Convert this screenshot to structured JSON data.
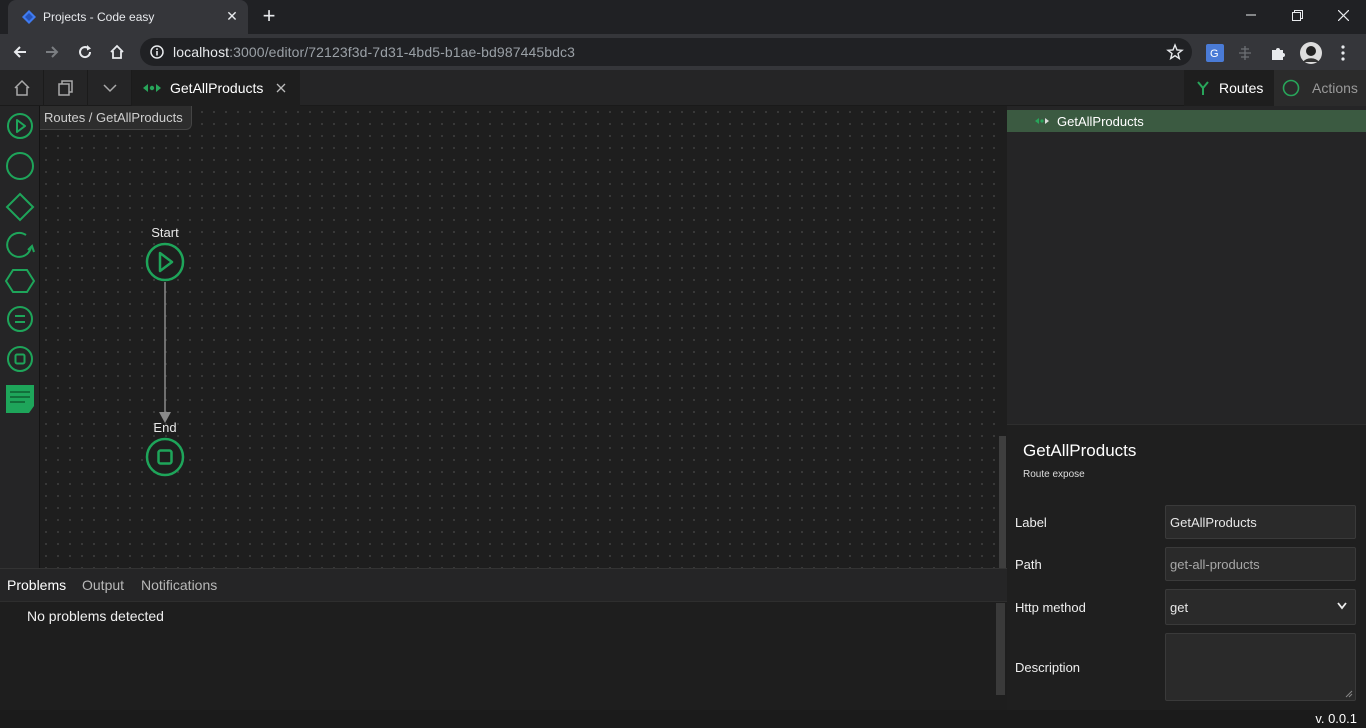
{
  "browser": {
    "tab_title": "Projects - Code easy",
    "url_host": "localhost",
    "url_rest": ":3000/editor/72123f3d-7d31-4bd5-b1ae-bd987445bdc3"
  },
  "editor": {
    "open_tab": "GetAllProducts",
    "right_tabs": {
      "routes": "Routes",
      "actions": "Actions"
    },
    "breadcrumb": "Routes / GetAllProducts",
    "nodes": {
      "start": "Start",
      "end": "End"
    },
    "palette_tools": [
      "start-icon",
      "circle-icon",
      "diamond-icon",
      "loop-icon",
      "hexagon-icon",
      "assign-icon",
      "end-icon",
      "comment-icon"
    ]
  },
  "bottom_panel": {
    "tabs": [
      "Problems",
      "Output",
      "Notifications"
    ],
    "message": "No problems detected"
  },
  "tree": {
    "selected": "GetAllProducts"
  },
  "properties": {
    "title": "GetAllProducts",
    "subtitle": "Route expose",
    "label_lbl": "Label",
    "label_val": "GetAllProducts",
    "path_lbl": "Path",
    "path_val": "get-all-products",
    "method_lbl": "Http method",
    "method_val": "get",
    "description_lbl": "Description",
    "description_val": ""
  },
  "status": {
    "version": "v. 0.0.1"
  },
  "colors": {
    "accent": "#1ea55a",
    "tree_selected": "#3b5a41"
  }
}
